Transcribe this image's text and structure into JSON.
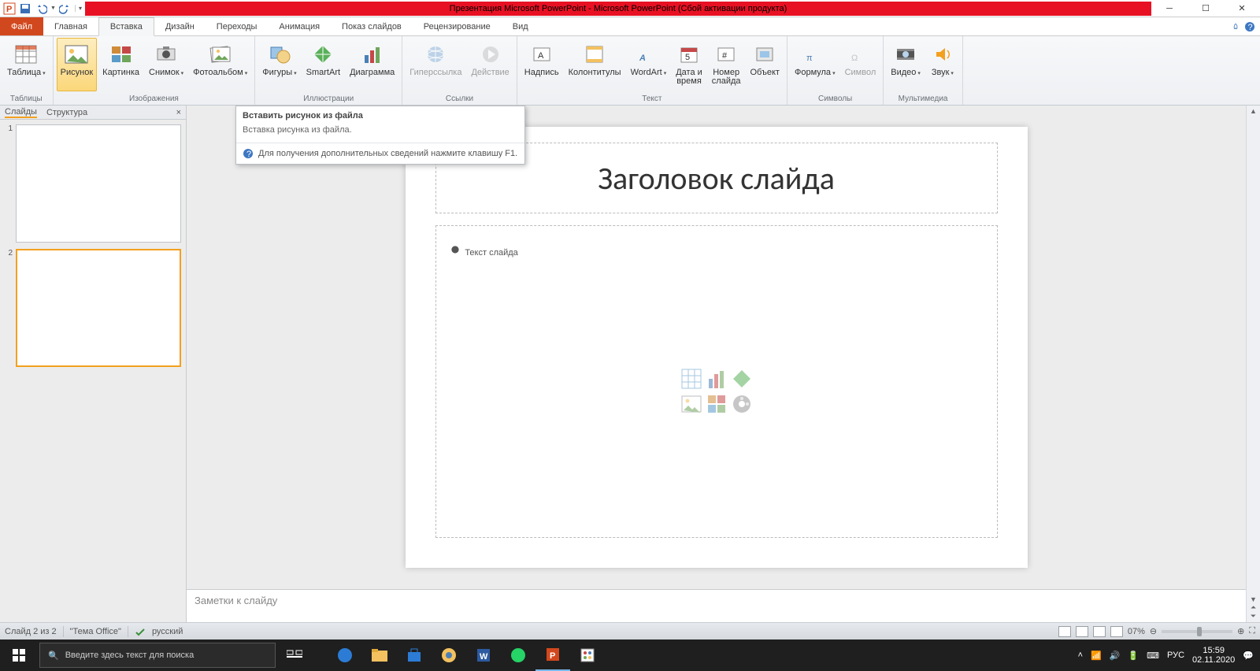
{
  "title": "Презентация Microsoft PowerPoint - Microsoft PowerPoint (Сбой активации продукта)",
  "tabs": {
    "file": "Файл",
    "home": "Главная",
    "insert": "Вставка",
    "design": "Дизайн",
    "trans": "Переходы",
    "anim": "Анимация",
    "show": "Показ слайдов",
    "review": "Рецензирование",
    "view": "Вид"
  },
  "groups": {
    "tables": {
      "label": "Таблицы",
      "table": "Таблица"
    },
    "images": {
      "label": "Изображения",
      "pic": "Рисунок",
      "clip": "Картинка",
      "shot": "Снимок",
      "album": "Фотоальбом"
    },
    "illus": {
      "label": "Иллюстрации",
      "shapes": "Фигуры",
      "smart": "SmartArt",
      "chart": "Диаграмма"
    },
    "links": {
      "label": "Ссылки",
      "hyper": "Гиперссылка",
      "action": "Действие"
    },
    "text": {
      "label": "Текст",
      "textbox": "Надпись",
      "hf": "Колонтитулы",
      "wordart": "WordArt",
      "date": "Дата и\nвремя",
      "num": "Номер\nслайда",
      "obj": "Объект"
    },
    "symbols": {
      "label": "Символы",
      "formula": "Формула",
      "symbol": "Символ"
    },
    "media": {
      "label": "Мультимедиа",
      "video": "Видео",
      "audio": "Звук"
    }
  },
  "panes": {
    "slides": "Слайды",
    "outline": "Структура"
  },
  "thumbs": [
    {
      "n": "1"
    },
    {
      "n": "2"
    }
  ],
  "slide": {
    "title": "Заголовок слайда",
    "body": "Текст слайда"
  },
  "notes": "Заметки к слайду",
  "tooltip": {
    "title": "Вставить рисунок из файла",
    "body": "Вставка рисунка из файла.",
    "foot": "Для получения дополнительных сведений нажмите клавишу F1."
  },
  "status": {
    "slide": "Слайд 2 из 2",
    "theme": "\"Тема Office\"",
    "lang": "русский",
    "zoom": "07%"
  },
  "taskbar": {
    "search": "Введите здесь текст для поиска",
    "time": "15:59",
    "date": "02.11.2020",
    "lang": "РУС"
  }
}
